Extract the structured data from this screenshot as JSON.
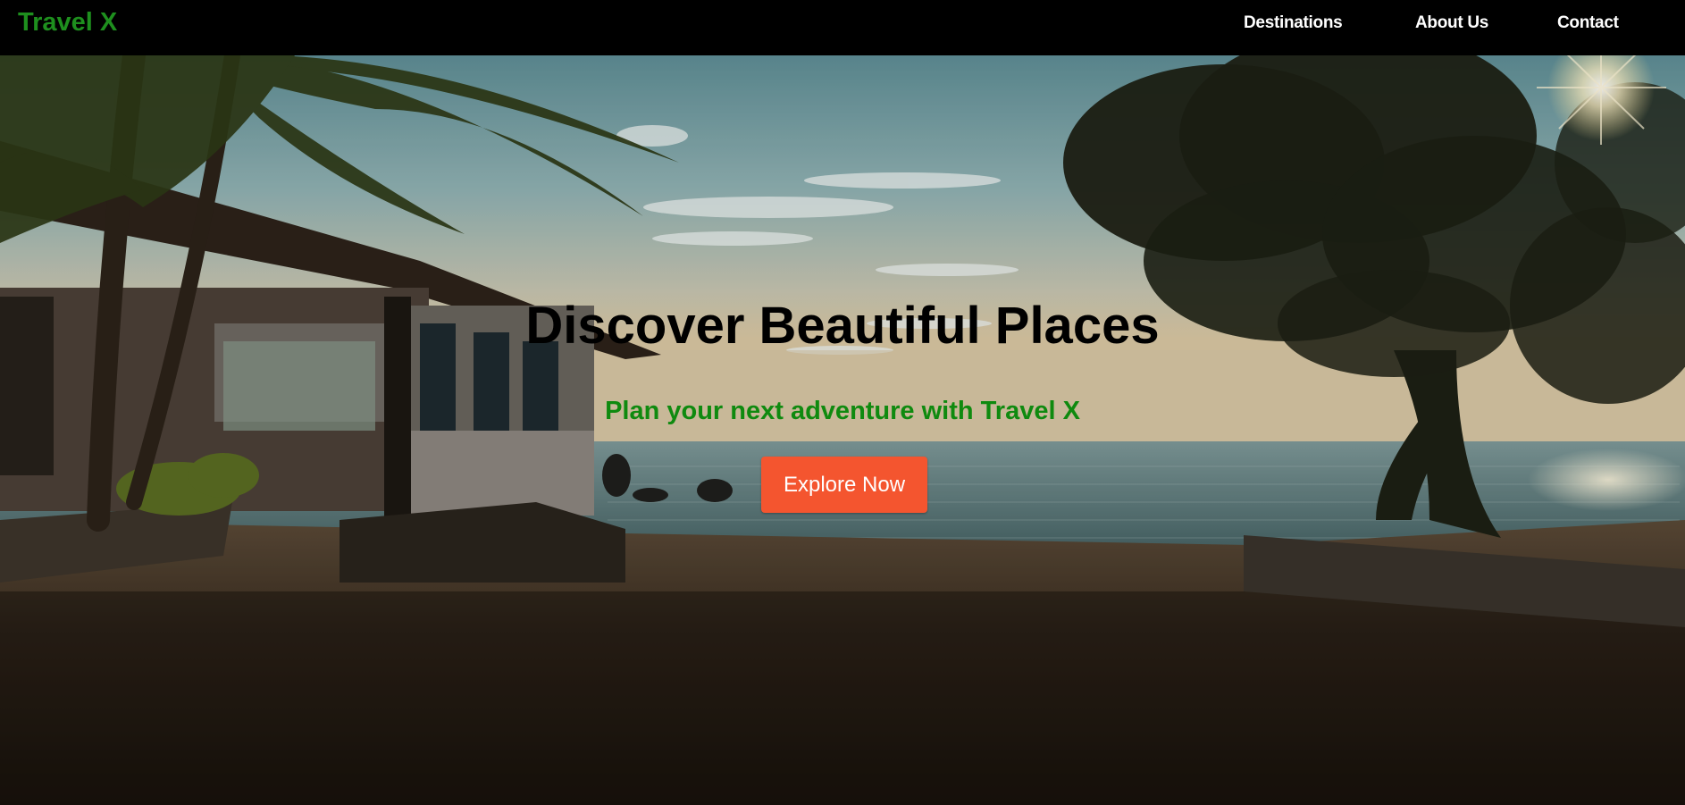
{
  "brand": {
    "name": "Travel X",
    "color": "#1e8f1e"
  },
  "nav": {
    "items": [
      {
        "label": "Destinations"
      },
      {
        "label": "About Us"
      },
      {
        "label": "Contact"
      }
    ]
  },
  "hero": {
    "title": "Discover Beautiful Places",
    "subtitle": "Plan your next adventure with Travel X",
    "subtitle_color": "#0f8a0f",
    "cta_label": "Explore Now",
    "cta_color": "#f4552f",
    "background_scene": "beach-sunset-photo"
  }
}
